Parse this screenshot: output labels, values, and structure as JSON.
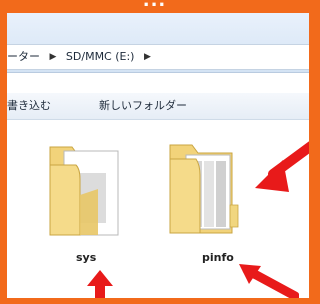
{
  "caption": "...",
  "address": {
    "crumb_prev": "ーター",
    "crumb_current": "SD/MMC (E:)"
  },
  "toolbar": {
    "write": "書き込む",
    "new_folder": "新しいフォルダー"
  },
  "files": [
    {
      "name": "sys"
    },
    {
      "name": "pinfo"
    }
  ],
  "colors": {
    "frame": "#f26a1b",
    "arrow": "#e81a1a",
    "folder": "#f2d272"
  }
}
